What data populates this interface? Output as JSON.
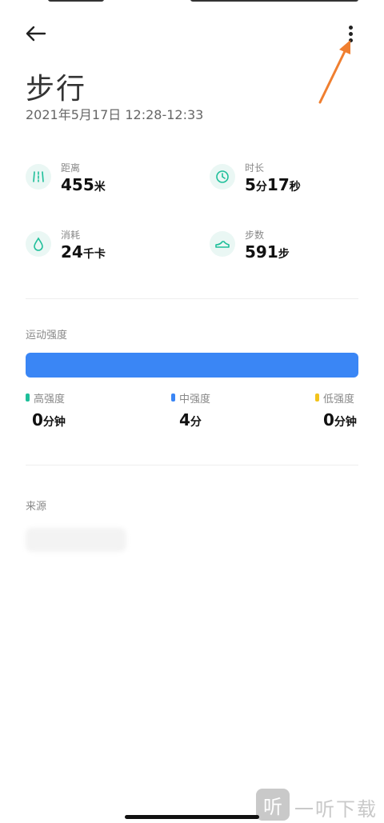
{
  "header": {
    "title": "步行",
    "datetime": "2021年5月17日 12:28-12:33"
  },
  "stats": {
    "distance": {
      "label": "距离",
      "value": "455",
      "unit": "米",
      "icon": "road-icon"
    },
    "duration": {
      "label": "时长",
      "value_a": "5",
      "unit_a": "分",
      "value_b": "17",
      "unit_b": "秒",
      "icon": "clock-icon"
    },
    "calories": {
      "label": "消耗",
      "value": "24",
      "unit": "千卡",
      "icon": "drop-icon"
    },
    "steps": {
      "label": "步数",
      "value": "591",
      "unit": "步",
      "icon": "shoe-icon"
    }
  },
  "intensity": {
    "section_label": "运动强度",
    "high": {
      "label": "高强度",
      "value": "0",
      "unit": "分钟",
      "color": "#1fbf9a"
    },
    "medium": {
      "label": "中强度",
      "value": "4",
      "unit": "分",
      "color": "#3a86f5"
    },
    "low": {
      "label": "低强度",
      "value": "0",
      "unit": "分钟",
      "color": "#f2c31b"
    },
    "bar_color": "#3a86f5"
  },
  "source": {
    "section_label": "来源"
  },
  "watermark": {
    "glyph": "听",
    "text": "一听下载"
  },
  "colors": {
    "accent": "#1fbf9a",
    "annotation_arrow": "#f07f30"
  }
}
